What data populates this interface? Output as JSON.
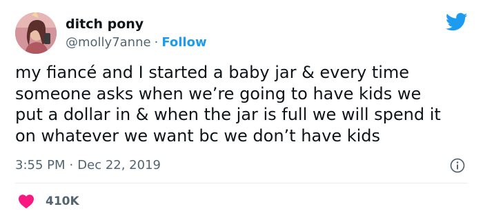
{
  "user": {
    "display_name": "ditch pony",
    "handle": "@molly7anne",
    "separator": "·",
    "follow_label": "Follow"
  },
  "tweet": {
    "text_lines": [
      "my fiancé and I started a baby jar & every time",
      "someone asks when we’re going to have kids we",
      "put a dollar in & when the jar is full we will spend it",
      "on whatever we want bc we don’t have kids"
    ],
    "time": "3:55 PM",
    "time_separator": "·",
    "date": "Dec 22, 2019"
  },
  "engagement": {
    "likes": "410K"
  },
  "icons": {
    "logo": "twitter-bird-icon",
    "info": "info-icon",
    "like": "heart-icon"
  },
  "colors": {
    "accent": "#1d9bf0",
    "heart": "#f91880",
    "text": "#0f1419",
    "muted": "#536471",
    "divider": "#e6ecf0"
  }
}
